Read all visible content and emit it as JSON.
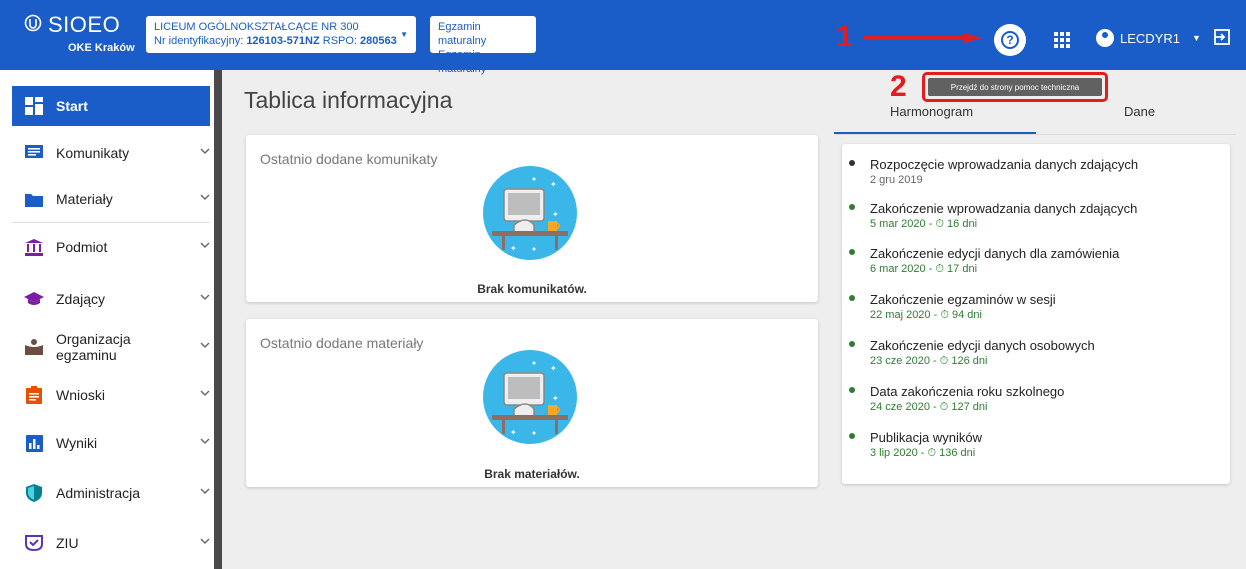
{
  "header": {
    "brand": "SIOEO",
    "brand_sub": "OKE Kraków",
    "school": {
      "name": "LICEUM OGÓLNOKSZTAŁCĄCE NR 300",
      "id_prefix": "Nr identyfikacyjny: ",
      "id_value": "126103-571NZ",
      "rspo_prefix": " RSPO: ",
      "rspo_value": "280563"
    },
    "exam": {
      "line1": "Egzamin maturalny",
      "line2": "Egzamin maturalny"
    },
    "user": "LECDYR1",
    "help_icon": "help-circle-icon",
    "apps_icon": "apps-grid-icon",
    "logout_icon": "logout-icon"
  },
  "annotations": {
    "num1": "1",
    "num2": "2",
    "tooltip": "Przejdź do strony pomoc techniczna"
  },
  "sidebar": {
    "items": [
      {
        "label": "Start",
        "icon": "dashboard-icon"
      },
      {
        "label": "Komunikaty",
        "icon": "message-icon"
      },
      {
        "label": "Materiały",
        "icon": "folder-icon"
      },
      {
        "label": "Podmiot",
        "icon": "institution-icon"
      },
      {
        "label": "Zdający",
        "icon": "graduation-cap-icon"
      },
      {
        "label": "Organizacja egzaminu",
        "icon": "organization-icon"
      },
      {
        "label": "Wnioski",
        "icon": "clipboard-icon"
      },
      {
        "label": "Wyniki",
        "icon": "chart-icon"
      },
      {
        "label": "Administracja",
        "icon": "shield-icon"
      },
      {
        "label": "ZIU",
        "icon": "ziu-icon"
      }
    ]
  },
  "main": {
    "title": "Tablica informacyjna",
    "cards": [
      {
        "title": "Ostatnio dodane komunikaty",
        "empty": "Brak komunikatów."
      },
      {
        "title": "Ostatnio dodane materiały",
        "empty": "Brak materiałów."
      }
    ]
  },
  "schedule": {
    "tabs": [
      "Harmonogram",
      "Dane"
    ],
    "events": [
      {
        "title": "Rozpoczęcie wprowadzania danych zdających",
        "date": "2 gru 2019",
        "status": "past"
      },
      {
        "title": "Zakończenie wprowadzania danych zdających",
        "date": "5 mar 2020 - ⏱ 16 dni",
        "status": "upcoming"
      },
      {
        "title": "Zakończenie edycji danych dla zamówienia",
        "date": "6 mar 2020 - ⏱ 17 dni",
        "status": "upcoming"
      },
      {
        "title": "Zakończenie egzaminów w sesji",
        "date": "22 maj 2020 - ⏱ 94 dni",
        "status": "upcoming"
      },
      {
        "title": "Zakończenie edycji danych osobowych",
        "date": "23 cze 2020 - ⏱ 126 dni",
        "status": "upcoming"
      },
      {
        "title": "Data zakończenia roku szkolnego",
        "date": "24 cze 2020 - ⏱ 127 dni",
        "status": "upcoming"
      },
      {
        "title": "Publikacja wyników",
        "date": "3 lip 2020 - ⏱ 136 dni",
        "status": "upcoming"
      }
    ]
  },
  "colors": {
    "primary": "#1a5dc8",
    "upcoming": "#2e7d32",
    "past": "#333333",
    "annotation": "#e21d1d"
  }
}
